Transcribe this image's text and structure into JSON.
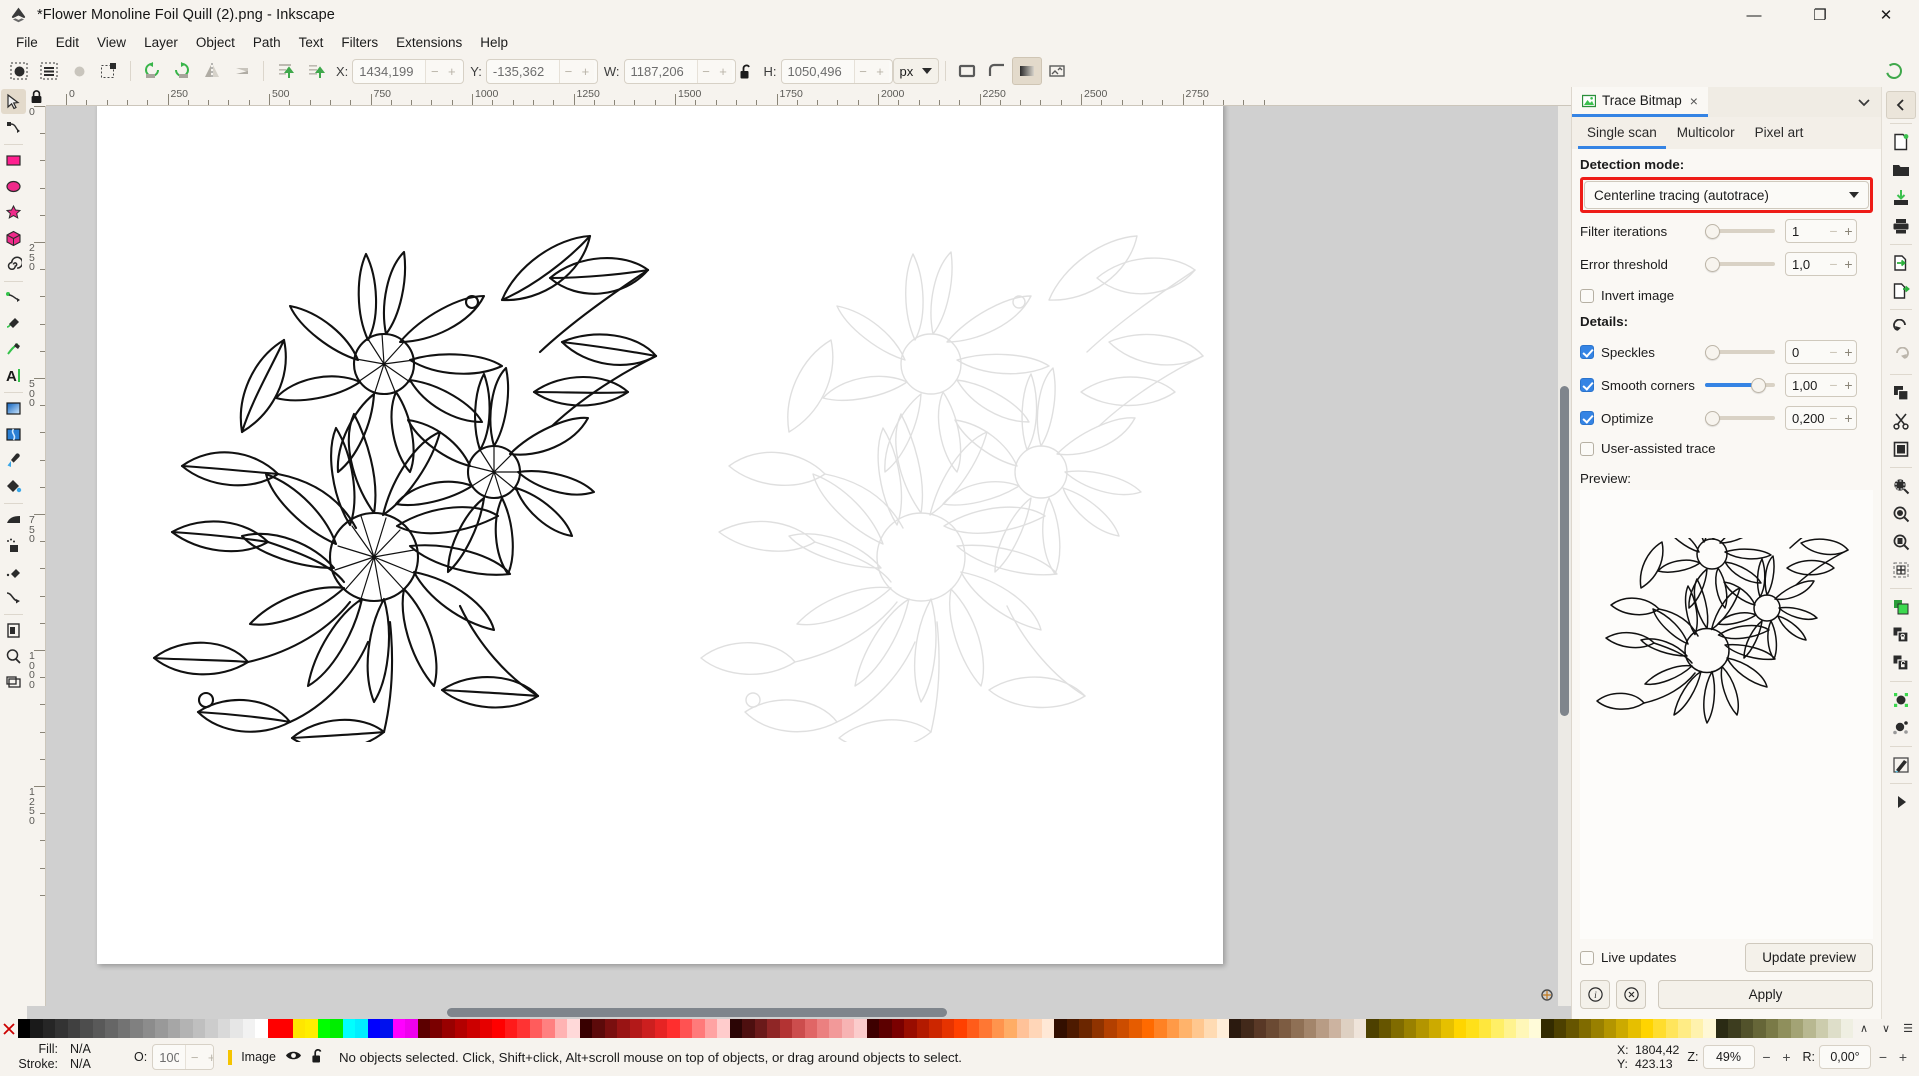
{
  "window": {
    "title": "*Flower Monoline Foil Quill (2).png - Inkscape",
    "app_icon": "inkscape-logo-icon",
    "minimize": "—",
    "maximize": "❐",
    "close": "✕"
  },
  "menu": {
    "items": [
      {
        "label": "File"
      },
      {
        "label": "Edit"
      },
      {
        "label": "View"
      },
      {
        "label": "Layer"
      },
      {
        "label": "Object"
      },
      {
        "label": "Path"
      },
      {
        "label": "Text"
      },
      {
        "label": "Filters"
      },
      {
        "label": "Extensions"
      },
      {
        "label": "Help"
      }
    ]
  },
  "toolbar": {
    "select_all_icon": "select-all-icon",
    "select_all_layers_icon": "select-all-layers-icon",
    "deselect_icon": "deselect-icon",
    "invert_selection_icon": "invert-selection-icon",
    "rotate_ccw_icon": "rotate-ccw-icon",
    "rotate_cw_icon": "rotate-cw-icon",
    "flip_horizontal_icon": "flip-horizontal-icon",
    "flip_vertical_icon": "flip-vertical-icon",
    "raise_to_top_icon": "raise-to-top-icon",
    "raise_icon": "raise-icon",
    "lower_icon": "lower-icon",
    "lower_to_bottom_icon": "lower-to-bottom-icon",
    "x_label": "X:",
    "x_value": "1434,199",
    "y_label": "Y:",
    "y_value": "-135,362",
    "w_label": "W:",
    "w_value": "1187,206",
    "h_label": "H:",
    "h_value": "1050,496",
    "lock_icon": "lock-open-icon",
    "unit": "px",
    "affect_stroke_icon": "affect-stroke-width-icon",
    "affect_corners_icon": "affect-rounded-corners-icon",
    "affect_gradients_icon": "affect-gradients-icon",
    "affect_patterns_icon": "affect-patterns-icon"
  },
  "tools": {
    "items": [
      {
        "name": "selector-tool",
        "icon": "arrow-cursor-icon",
        "active": true
      },
      {
        "name": "node-tool",
        "icon": "node-editor-icon",
        "active": false
      },
      {
        "name": "rectangle-tool",
        "icon": "rectangle-icon",
        "active": false
      },
      {
        "name": "ellipse-tool",
        "icon": "ellipse-icon",
        "active": false
      },
      {
        "name": "star-tool",
        "icon": "star-icon",
        "active": false
      },
      {
        "name": "3dbox-tool",
        "icon": "3d-box-icon",
        "active": false
      },
      {
        "name": "spiral-tool",
        "icon": "spiral-icon",
        "active": false
      },
      {
        "name": "pencil-tool",
        "icon": "pencil-freehand-icon",
        "active": false
      },
      {
        "name": "pen-tool",
        "icon": "bezier-pen-icon",
        "active": false
      },
      {
        "name": "calligraphy-tool",
        "icon": "calligraphy-icon",
        "active": false
      },
      {
        "name": "text-tool",
        "icon": "text-A-icon",
        "active": false
      },
      {
        "name": "gradient-tool",
        "icon": "gradient-icon",
        "active": false
      },
      {
        "name": "mesh-tool",
        "icon": "mesh-gradient-icon",
        "active": false
      },
      {
        "name": "dropper-tool",
        "icon": "color-picker-icon",
        "active": false
      },
      {
        "name": "paint-bucket-tool",
        "icon": "paint-bucket-icon",
        "active": false
      },
      {
        "name": "tweak-tool",
        "icon": "tweak-icon",
        "active": false
      },
      {
        "name": "spray-tool",
        "icon": "spray-icon",
        "active": false
      },
      {
        "name": "eraser-tool",
        "icon": "eraser-icon",
        "active": false
      },
      {
        "name": "connector-tool",
        "icon": "connector-icon",
        "active": false
      },
      {
        "name": "page-tool",
        "icon": "page-icon",
        "active": false
      },
      {
        "name": "zoom-tool",
        "icon": "magnifier-icon",
        "active": false
      },
      {
        "name": "measure-tool",
        "icon": "measure-icon",
        "active": false
      }
    ]
  },
  "rulers": {
    "unit": "px",
    "h_labels": [
      "0",
      "250",
      "500",
      "750",
      "1000",
      "1250",
      "1500",
      "1750",
      "2000",
      "2250",
      "2500",
      "2750"
    ],
    "v_labels": [
      "0",
      "250",
      "500",
      "750",
      "1000",
      "1250"
    ],
    "corner_icon": "ruler-lock-icon",
    "zoom_badge_icon": "zoom-badge-icon"
  },
  "dock": {
    "tab_title": "Trace Bitmap",
    "tab_icon": "trace-bitmap-icon",
    "tab_close": "×",
    "collapse_icon": "chevron-down-icon",
    "subtabs": [
      {
        "label": "Single scan",
        "active": true
      },
      {
        "label": "Multicolor",
        "active": false
      },
      {
        "label": "Pixel art",
        "active": false
      }
    ],
    "detection_mode_label": "Detection mode:",
    "detection_mode_value": "Centerline tracing (autotrace)",
    "detection_mode_highlight_color": "#ee1c17",
    "params": [
      {
        "name": "filter-iterations",
        "label": "Filter iterations",
        "value": "1",
        "slider_pct": 3,
        "fill_pct": 0
      },
      {
        "name": "error-threshold",
        "label": "Error threshold",
        "value": "1,0",
        "slider_pct": 3,
        "fill_pct": 0
      }
    ],
    "invert_image": {
      "label": "Invert image",
      "checked": false
    },
    "details_label": "Details:",
    "details": [
      {
        "name": "speckles",
        "label": "Speckles",
        "checked": true,
        "value": "0",
        "slider_pct": 3,
        "fill_pct": 0
      },
      {
        "name": "smooth-corners",
        "label": "Smooth corners",
        "checked": true,
        "value": "1,00",
        "slider_pct": 68,
        "fill_pct": 68
      },
      {
        "name": "optimize",
        "label": "Optimize",
        "checked": true,
        "value": "0,200",
        "slider_pct": 3,
        "fill_pct": 0
      }
    ],
    "user_assisted": {
      "label": "User-assisted trace",
      "checked": false
    },
    "preview_label": "Preview:",
    "live_updates": {
      "label": "Live updates",
      "checked": false
    },
    "update_preview_label": "Update preview",
    "apply_label": "Apply",
    "info_icon": "info-circle-icon",
    "reset_icon": "reset-circle-icon",
    "accent_color": "#3584e4"
  },
  "snapbar": {
    "toggle_icon": "collapse-left-icon",
    "items": [
      {
        "name": "new-document",
        "icon": "new-document-icon"
      },
      {
        "name": "open-document",
        "icon": "open-folder-icon"
      },
      {
        "name": "save-document",
        "icon": "save-icon"
      },
      {
        "name": "print-document",
        "icon": "printer-icon"
      },
      {
        "name": "import",
        "icon": "import-icon"
      },
      {
        "name": "export",
        "icon": "export-icon"
      },
      {
        "name": "undo",
        "icon": "undo-arrow-icon"
      },
      {
        "name": "redo",
        "icon": "redo-arrow-icon"
      },
      {
        "name": "copy",
        "icon": "copy-icon"
      },
      {
        "name": "cut",
        "icon": "scissors-icon"
      },
      {
        "name": "paste",
        "icon": "clipboard-icon"
      },
      {
        "name": "zoom-selection",
        "icon": "zoom-selection-icon"
      },
      {
        "name": "zoom-drawing",
        "icon": "zoom-drawing-icon"
      },
      {
        "name": "zoom-page",
        "icon": "zoom-page-icon"
      },
      {
        "name": "fit-page",
        "icon": "fit-page-icon"
      },
      {
        "name": "duplicate",
        "icon": "duplicate-green-icon"
      },
      {
        "name": "group",
        "icon": "group-icon"
      },
      {
        "name": "ungroup",
        "icon": "ungroup-icon"
      },
      {
        "name": "object-properties",
        "icon": "object-nodes-icon"
      },
      {
        "name": "object-transform",
        "icon": "object-transform-icon"
      },
      {
        "name": "edit-paint",
        "icon": "paint-edit-icon"
      },
      {
        "name": "play",
        "icon": "play-triangle-icon"
      }
    ]
  },
  "palette": {
    "none_icon": "no-color-X-icon",
    "scroll_up_icon": "∧",
    "scroll_down_icon": "∨",
    "menu_icon": "☰",
    "swatches": [
      "#000000",
      "#1a1a1a",
      "#262626",
      "#333333",
      "#404040",
      "#4d4d4d",
      "#595959",
      "#666666",
      "#737373",
      "#808080",
      "#8c8c8c",
      "#999999",
      "#a6a6a6",
      "#b3b3b3",
      "#bfbfbf",
      "#cccccc",
      "#d9d9d9",
      "#e6e6e6",
      "#f2f2f2",
      "#ffffff",
      "#ff0000",
      "#ff0000",
      "#ffe600",
      "#ffee00",
      "#00ff00",
      "#00ee00",
      "#00ffff",
      "#00eeff",
      "#0000ff",
      "#0011ee",
      "#ff00ff",
      "#ee00ee",
      "#5c0000",
      "#7a0000",
      "#990000",
      "#b30000",
      "#cc0000",
      "#e60000",
      "#ff0000",
      "#ff1a1a",
      "#ff3333",
      "#ff5c5c",
      "#ff8080",
      "#ffb3b3",
      "#ffd9d9",
      "#380000",
      "#5c0a0a",
      "#7a0f0f",
      "#991414",
      "#b31919",
      "#cc1f1f",
      "#e62424",
      "#ff2e2e",
      "#ff5252",
      "#ff7a7a",
      "#ffa3a3",
      "#ffcccc",
      "#2b0505",
      "#4d0f0f",
      "#6b1a1a",
      "#8f2626",
      "#b33333",
      "#cc4d4d",
      "#e06666",
      "#eb8080",
      "#f29999",
      "#f7b3b3",
      "#fbcccc",
      "#3d0000",
      "#5c0000",
      "#7a0000",
      "#990d00",
      "#b31a00",
      "#cc2600",
      "#e63300",
      "#ff4000",
      "#ff5c1a",
      "#ff7733",
      "#ff944d",
      "#ffad66",
      "#ffc299",
      "#ffd6b8",
      "#ffe8d6",
      "#330f00",
      "#4d1a00",
      "#6b2600",
      "#8f3300",
      "#b34000",
      "#cc4d00",
      "#e65c00",
      "#ff6a00",
      "#ff8224",
      "#ff9a47",
      "#ffb36b",
      "#ffc78f",
      "#ffdbb3",
      "#ffeed9",
      "#2b1a0f",
      "#42291a",
      "#593826",
      "#6b4a33",
      "#7d5c42",
      "#8f7055",
      "#a3856b",
      "#b89c85",
      "#ccb3a0",
      "#ded0c2",
      "#efe4da",
      "#4d4000",
      "#665500",
      "#806b00",
      "#998000",
      "#b39500",
      "#ccaa00",
      "#e6c000",
      "#ffd500",
      "#ffe01a",
      "#ffe73d",
      "#ffef66",
      "#fff38f",
      "#fff7b8",
      "#fffbd9",
      "#332b00",
      "#4d4000",
      "#665500",
      "#806b00",
      "#998000",
      "#b39500",
      "#ccaa00",
      "#e6bf00",
      "#ffd400",
      "#ffdd2e",
      "#ffe55c",
      "#ffec85",
      "#fff2ad",
      "#fff8d6",
      "#2b2b14",
      "#3d3d1f",
      "#52522b",
      "#666638",
      "#7a7a47",
      "#8f8f5c",
      "#a3a375",
      "#b8b891",
      "#ccccad",
      "#dedec9",
      "#efefe2"
    ]
  },
  "statusbar": {
    "fill_label": "Fill:",
    "fill_value": "N/A",
    "stroke_label": "Stroke:",
    "stroke_value": "N/A",
    "opacity_label": "O:",
    "opacity_value": "100",
    "layer_name": "Image",
    "layer_visibility_icon": "eye-icon",
    "layer_lock_icon": "lock-open-icon",
    "message": "No objects selected. Click, Shift+click, Alt+scroll mouse on top of objects, or drag around objects to select.",
    "cursor_x_label": "X:",
    "cursor_x_value": "1804,42",
    "cursor_y_label": "Y:",
    "cursor_y_value": "423.13",
    "zoom_label": "Z:",
    "zoom_value": "49%",
    "rotation_label": "R:",
    "rotation_value": "0,00°",
    "minus": "−",
    "plus": "+"
  }
}
